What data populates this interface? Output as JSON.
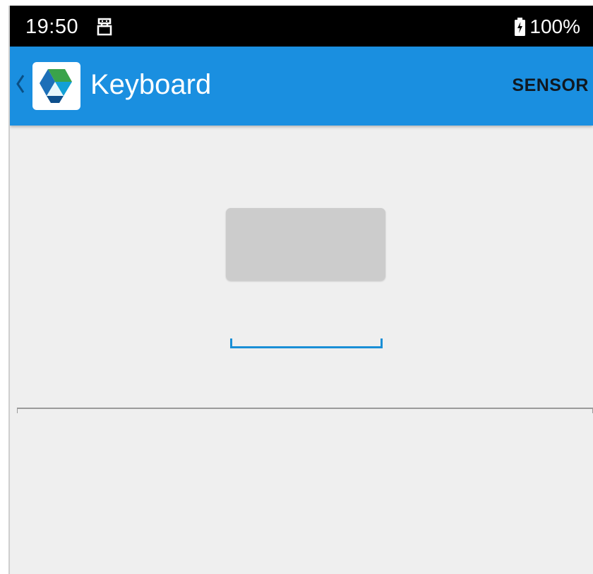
{
  "status_bar": {
    "time": "19:50",
    "battery_percent": "100%",
    "notification_icon": "usb-debug-icon",
    "battery_icon": "battery-charging-icon"
  },
  "app_bar": {
    "title": "Keyboard",
    "action_label": "SENSOR",
    "back_icon": "chevron-left-icon",
    "app_icon": "app-logo-icon",
    "background_color": "#1a8fe0"
  },
  "main": {
    "button_label": "",
    "text_field": {
      "value": "",
      "accent_color": "#1a8fd6"
    }
  }
}
